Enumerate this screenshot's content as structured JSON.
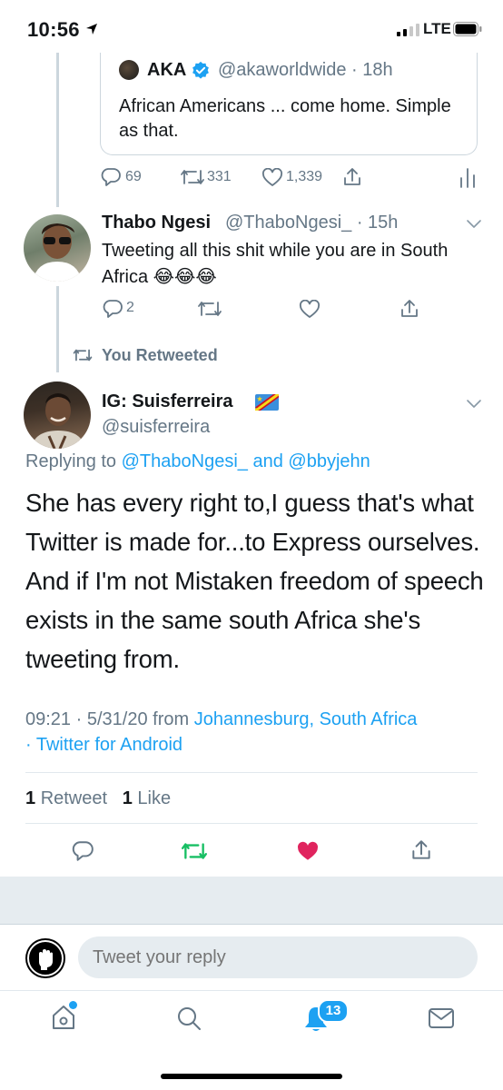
{
  "status_bar": {
    "time": "10:56",
    "network": "LTE"
  },
  "quoted_tweet": {
    "name": "AKA",
    "handle": "@akaworldwide",
    "age": "· 18h",
    "text": "African Americans ... come home. Simple as that.",
    "actions": {
      "replies": "69",
      "retweets": "331",
      "likes": "1,339"
    }
  },
  "tweet1": {
    "name": "Thabo Ngesi",
    "handle": "@ThaboNgesi_",
    "age": "· 15h",
    "text": "Tweeting all this shit while you are in South Africa 😂😂😂",
    "actions": {
      "replies": "2"
    }
  },
  "retweet_label": "You Retweeted",
  "main_tweet": {
    "name": "IG: Suisferreira",
    "handle": "@suisferreira",
    "replying_prefix": "Replying to",
    "replying_user1": "@ThaboNgesi_",
    "replying_and": "and",
    "replying_user2": "@bbyjehn",
    "text": "She has every right to,I guess that's what Twitter is made for...to Express ourselves. And if I'm not Mistaken freedom of speech exists in the same south Africa she's tweeting from.",
    "time": "09:21",
    "date": "5/31/20",
    "from_label": "from",
    "location": "Johannesburg, South Africa",
    "client": "Twitter for Android",
    "retweet_count": "1",
    "retweet_label": "Retweet",
    "like_count": "1",
    "like_label": "Like"
  },
  "reply_box": {
    "placeholder": "Tweet your reply"
  },
  "tab_bar": {
    "notifications_badge": "13"
  },
  "colors": {
    "accent": "#1da1f2",
    "retweet_green": "#17bf63",
    "like_red": "#e0245e",
    "muted": "#657786"
  },
  "icons": [
    "location-arrow-icon",
    "signal-icon",
    "battery-icon",
    "verified-icon",
    "reply-icon",
    "retweet-icon",
    "like-icon",
    "share-icon",
    "analytics-icon",
    "chevron-down-icon",
    "home-icon",
    "search-icon",
    "notifications-icon",
    "messages-icon"
  ]
}
